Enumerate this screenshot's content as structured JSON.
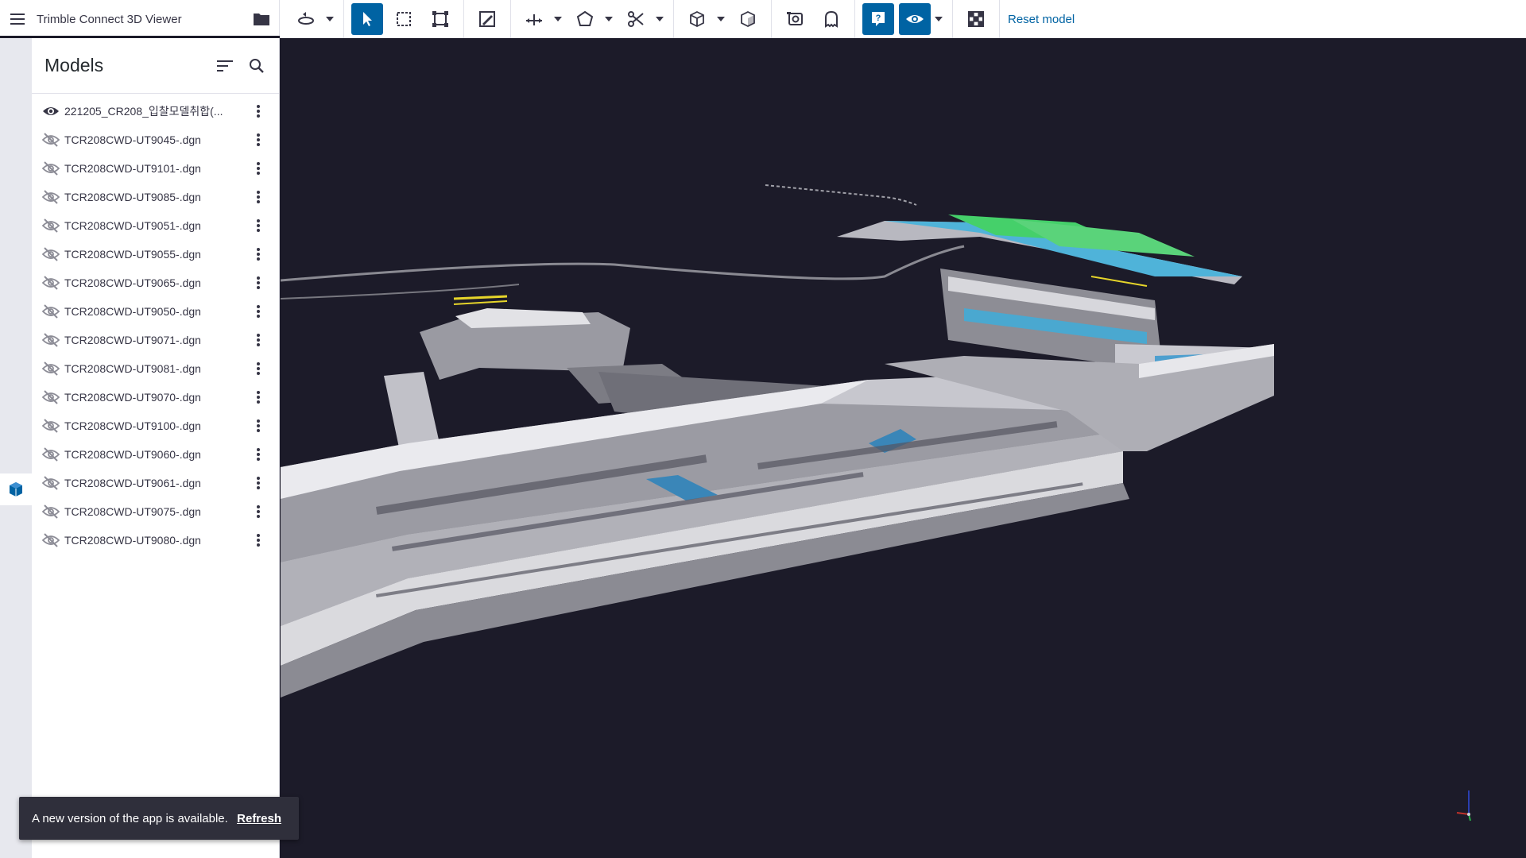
{
  "app": {
    "title": "Trimble Connect 3D Viewer",
    "menu_icon": "hamburger-menu-icon",
    "folder_icon": "folder-icon"
  },
  "toolbar": {
    "reset_label": "Reset model",
    "accent_color": "#0063a3",
    "tools": [
      {
        "name": "orbit-icon",
        "active": false,
        "has_dropdown": true
      },
      {
        "name": "select-pointer-icon",
        "active": true,
        "has_dropdown": false
      },
      {
        "name": "area-select-icon",
        "active": false,
        "has_dropdown": false
      },
      {
        "name": "fit-to-view-icon",
        "active": false,
        "has_dropdown": false
      },
      {
        "name": "markup-icon",
        "active": false,
        "has_dropdown": false
      },
      {
        "name": "measure-icon",
        "active": false,
        "has_dropdown": true
      },
      {
        "name": "shape-icon",
        "active": false,
        "has_dropdown": true
      },
      {
        "name": "cut-scissors-icon",
        "active": false,
        "has_dropdown": true
      },
      {
        "name": "section-box-icon",
        "active": false,
        "has_dropdown": true
      },
      {
        "name": "section-plane-icon",
        "active": false,
        "has_dropdown": false
      },
      {
        "name": "snapshot-icon",
        "active": false,
        "has_dropdown": false
      },
      {
        "name": "ghost-icon",
        "active": false,
        "has_dropdown": false
      },
      {
        "name": "help-icon",
        "active": true,
        "has_dropdown": false
      },
      {
        "name": "visibility-eye-icon",
        "active": true,
        "has_dropdown": true
      },
      {
        "name": "grid-checker-icon",
        "active": false,
        "has_dropdown": false
      }
    ]
  },
  "panel": {
    "title": "Models",
    "sort_icon": "sort-icon",
    "search_icon": "search-icon",
    "models": [
      {
        "name": "221205_CR208_입찰모델취합(...",
        "visible": true
      },
      {
        "name": "TCR208CWD-UT9045-.dgn",
        "visible": false
      },
      {
        "name": "TCR208CWD-UT9101-.dgn",
        "visible": false
      },
      {
        "name": "TCR208CWD-UT9085-.dgn",
        "visible": false
      },
      {
        "name": "TCR208CWD-UT9051-.dgn",
        "visible": false
      },
      {
        "name": "TCR208CWD-UT9055-.dgn",
        "visible": false
      },
      {
        "name": "TCR208CWD-UT9065-.dgn",
        "visible": false
      },
      {
        "name": "TCR208CWD-UT9050-.dgn",
        "visible": false
      },
      {
        "name": "TCR208CWD-UT9071-.dgn",
        "visible": false
      },
      {
        "name": "TCR208CWD-UT9081-.dgn",
        "visible": false
      },
      {
        "name": "TCR208CWD-UT9070-.dgn",
        "visible": false
      },
      {
        "name": "TCR208CWD-UT9100-.dgn",
        "visible": false
      },
      {
        "name": "TCR208CWD-UT9060-.dgn",
        "visible": false
      },
      {
        "name": "TCR208CWD-UT9061-.dgn",
        "visible": false
      },
      {
        "name": "TCR208CWD-UT9075-.dgn",
        "visible": false
      },
      {
        "name": "TCR208CWD-UT9080-.dgn",
        "visible": false
      }
    ]
  },
  "rail": {
    "models_icon": "models-cube-icon"
  },
  "toast": {
    "message": "A new version of the app is available.",
    "action": "Refresh"
  },
  "viewport": {
    "background": "#1c1b29"
  }
}
